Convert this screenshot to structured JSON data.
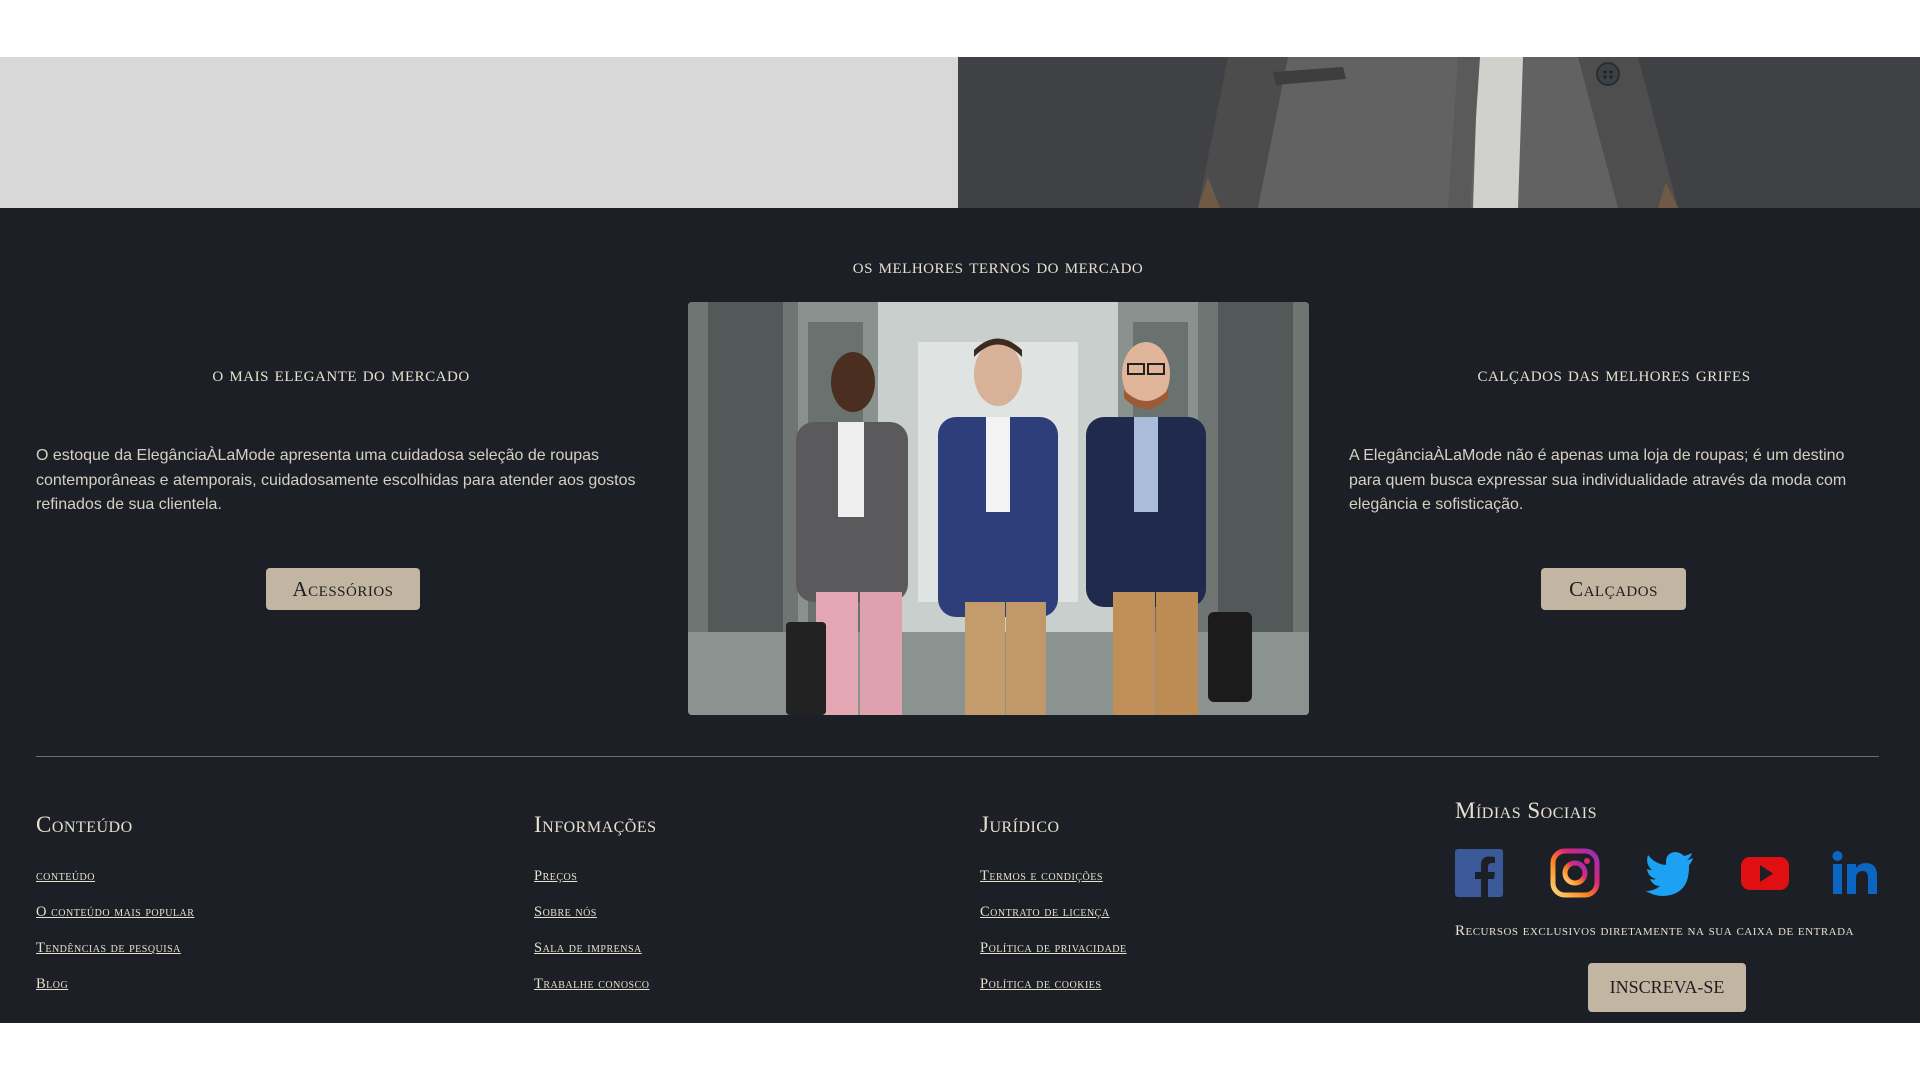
{
  "hero": {
    "left_color": "#d8d8d8",
    "right_color": "#404145"
  },
  "section": {
    "title": "os melhores ternos do mercado",
    "left": {
      "title": "o mais elegante do mercado",
      "text": "O estoque da ElegânciaÀLaMode apresenta uma cuidadosa seleção de roupas contemporâneas e atemporais, cuidadosamente escolhidas para atender aos gostos refinados de sua clientela.",
      "button": "Acessórios"
    },
    "right": {
      "title": "calçados das melhores grifes",
      "text": "A ElegânciaÀLaMode não é apenas uma loja de roupas; é um destino para quem busca expressar sua individualidade através da moda com elegância e sofisticação.",
      "button": "Calçados"
    }
  },
  "footer": {
    "conteudo": {
      "title": "Conteúdo",
      "links": [
        "conteúdo",
        "O conteúdo mais popular",
        "Tendências de pesquisa",
        "Blog"
      ]
    },
    "informacoes": {
      "title": "Informações",
      "links": [
        "Preços",
        "Sobre nós",
        "Sala de imprensa",
        "Trabalhe conosco"
      ]
    },
    "juridico": {
      "title": "Jurídico",
      "links": [
        "Termos e condições",
        "Contrato de licença",
        "Política de privacidade",
        "Política de cookies"
      ]
    },
    "social": {
      "title": "Mídias Sociais",
      "icons": [
        "facebook-icon",
        "instagram-icon",
        "twitter-icon",
        "youtube-icon",
        "linkedin-icon"
      ],
      "tagline": "Recursos exclusivos diretamente na sua caixa de entrada",
      "button": "INSCREVA-SE"
    }
  },
  "colors": {
    "dark_bg": "#1c2026",
    "accent_button": "#c2b5a2",
    "text": "#e8dfcf"
  }
}
